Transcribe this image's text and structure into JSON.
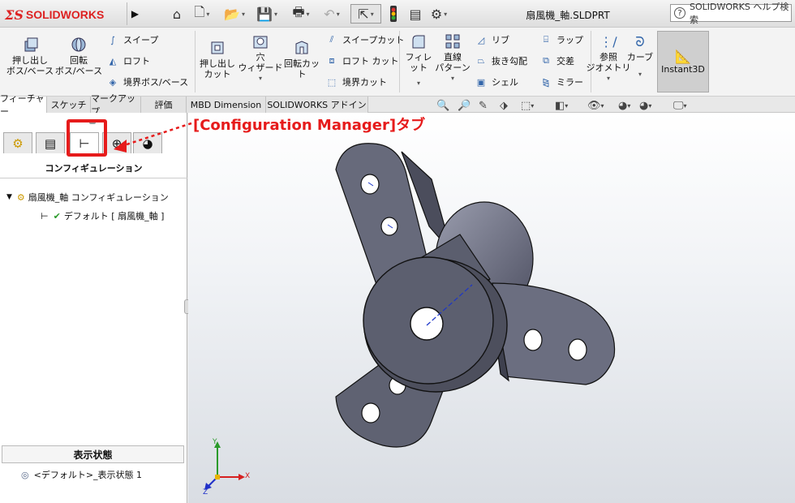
{
  "app": {
    "brand": "SOLIDWORKS",
    "document_title": "扇風機_軸.SLDPRT",
    "help_search": "SOLIDWORKS ヘルプ検索"
  },
  "ribbon": {
    "extrude_boss": "押し出し\nボス/ベース",
    "revolve_boss": "回転\nボス/ベース",
    "sweep": "スイープ",
    "loft": "ロフト",
    "boundary_boss": "境界ボス/ベース",
    "extrude_cut": "押し出し\nカット",
    "hole_wizard": "穴\nウィザード",
    "revolve_cut": "回転カット",
    "sweep_cut": "スイープカット",
    "loft_cut": "ロフト カット",
    "boundary_cut": "境界カット",
    "fillet": "フィレット",
    "linear_pattern": "直線\nパターン",
    "rib": "リブ",
    "draft": "抜き勾配",
    "shell": "シェル",
    "wrap": "ラップ",
    "intersect": "交差",
    "mirror": "ミラー",
    "reference_geometry": "参照\nジオメトリ",
    "curves": "カーブ",
    "instant3d": "Instant3D"
  },
  "tabs": [
    "フィーチャー",
    "スケッチ",
    "マークアップ",
    "評価",
    "MBD Dimension",
    "SOLIDWORKS アドイン"
  ],
  "panel": {
    "title": "コンフィギュレーション",
    "tree_root": "扇風機_軸 コンフィギュレーション",
    "tree_child": "デフォルト [ 扇風機_軸 ]",
    "display_state_header": "表示状態",
    "display_state_item": "<デフォルト>_表示状態 1"
  },
  "annotation": {
    "label": "[Configuration Manager]タブ",
    "color": "#e61b1b"
  },
  "axes": {
    "x": "X",
    "y": "Y",
    "z": "Z"
  }
}
